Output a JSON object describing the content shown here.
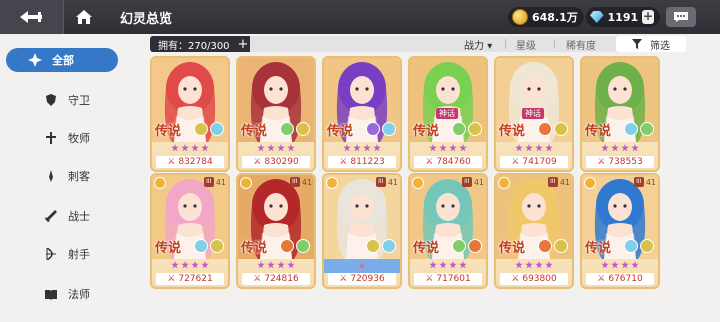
{
  "header": {
    "title": "幻灵总览",
    "gold": "648.1万",
    "gems": "1191",
    "plus": "+"
  },
  "sidebar": {
    "items": [
      {
        "label": "全部",
        "icon": "star-burst-icon",
        "active": true
      },
      {
        "label": "守卫",
        "icon": "shield-icon"
      },
      {
        "label": "牧师",
        "icon": "priest-icon"
      },
      {
        "label": "刺客",
        "icon": "dagger-icon"
      },
      {
        "label": "战士",
        "icon": "sword-icon"
      },
      {
        "label": "射手",
        "icon": "bow-icon"
      },
      {
        "label": "法师",
        "icon": "book-icon"
      }
    ]
  },
  "filter": {
    "owned": "拥有：270/300",
    "plus": "+",
    "power": "战力",
    "power_arrow": "▾",
    "star": "星级",
    "rarity": "稀有度",
    "filter_label": "筛选"
  },
  "cards": [
    {
      "rarity": "传说",
      "power": "832784",
      "hair": "#e04a4a",
      "bg": "#f3c88a",
      "elem": "#d9c24a",
      "elem2": "#7fd0e8"
    },
    {
      "rarity": "传说",
      "power": "830290",
      "hair": "#a8323a",
      "bg": "#e9b474",
      "elem": "#7fce6a",
      "elem2": "#d9c24a"
    },
    {
      "rarity": "传说",
      "power": "811223",
      "hair": "#7a3ec2",
      "bg": "#f1c685",
      "elem": "#9a6ad6",
      "elem2": "#7fd0e8"
    },
    {
      "rarity": "传说",
      "power": "784760",
      "hair": "#7ad050",
      "bg": "#eec27d",
      "elem": "#7fce6a",
      "elem2": "#d9c24a",
      "special": "神话"
    },
    {
      "rarity": "传说",
      "power": "741709",
      "hair": "#efe6d6",
      "bg": "#f3cf96",
      "elem": "#e7763a",
      "elem2": "#d9c24a",
      "special": "神话"
    },
    {
      "rarity": "传说",
      "power": "738553",
      "hair": "#6fb04a",
      "bg": "#eec580",
      "elem": "#7fd0e8",
      "elem2": "#7fce6a"
    },
    {
      "rarity": "传说",
      "power": "727621",
      "hair": "#f2a7c6",
      "bg": "#f2c987",
      "elem": "#7fd0e8",
      "elem2": "#d9c24a",
      "level": "41"
    },
    {
      "rarity": "传说",
      "power": "724816",
      "hair": "#b4282c",
      "bg": "#e5ab66",
      "elem": "#e7763a",
      "elem2": "#7fce6a",
      "level": "41"
    },
    {
      "rarity": "",
      "power": "720936",
      "hair": "#e9e4dc",
      "bg": "#f5d59e",
      "elem": "#d9c24a",
      "elem2": "#7fd0e8",
      "level": "41",
      "blue": true
    },
    {
      "rarity": "传说",
      "power": "717601",
      "hair": "#74c7b8",
      "bg": "#f1c888",
      "elem": "#7fce6a",
      "elem2": "#e7763a",
      "level": "41"
    },
    {
      "rarity": "传说",
      "power": "693800",
      "hair": "#f0c86a",
      "bg": "#eec27d",
      "elem": "#e7763a",
      "elem2": "#d9c24a",
      "level": "41"
    },
    {
      "rarity": "传说",
      "power": "676710",
      "hair": "#2f7ad0",
      "bg": "#f4cf96",
      "elem": "#7fd0e8",
      "elem2": "#d9c24a",
      "level": "41"
    }
  ],
  "power_prefix": "⚔"
}
